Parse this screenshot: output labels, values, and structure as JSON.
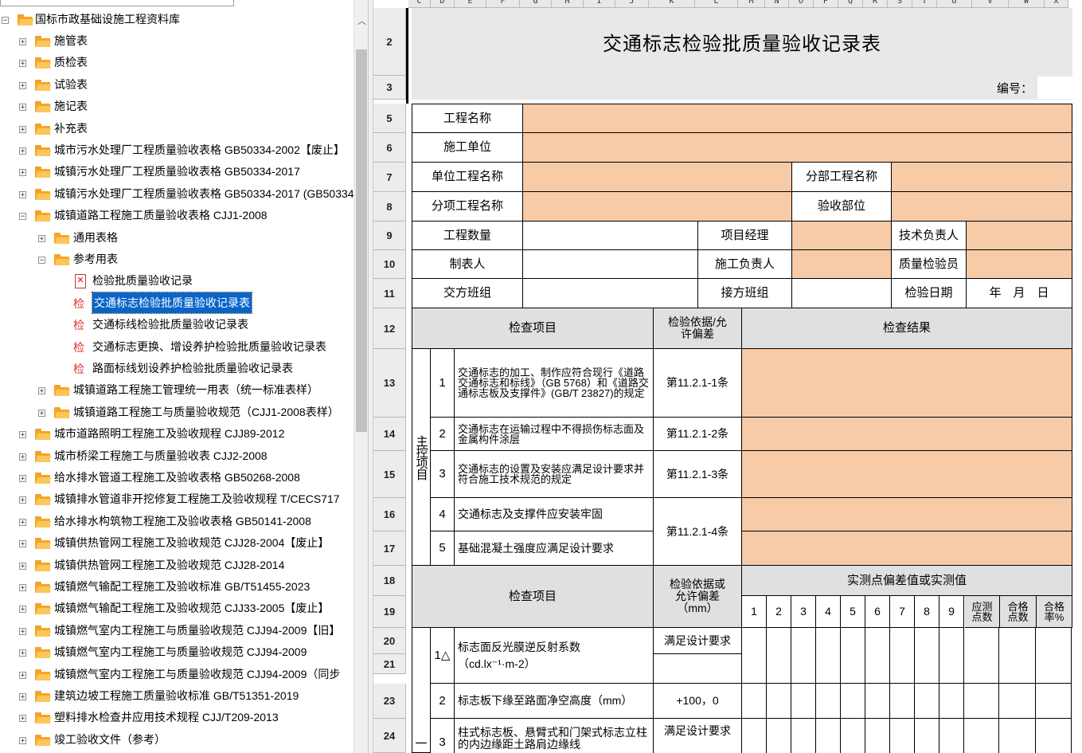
{
  "tree": {
    "root": "国标市政基础设施工程资料库",
    "items": [
      {
        "label": "施管表",
        "level": 1,
        "icon": "folder-icon",
        "exp": "+"
      },
      {
        "label": "质检表",
        "level": 1,
        "icon": "folder-icon",
        "exp": "+"
      },
      {
        "label": "试验表",
        "level": 1,
        "icon": "folder-icon",
        "exp": "+"
      },
      {
        "label": "施记表",
        "level": 1,
        "icon": "folder-icon",
        "exp": "+"
      },
      {
        "label": "补充表",
        "level": 1,
        "icon": "folder-icon",
        "exp": "+"
      },
      {
        "label": "城市污水处理厂工程质量验收表格 GB50334-2002【废止】",
        "level": 1,
        "icon": "folder-icon",
        "exp": "+"
      },
      {
        "label": "城镇污水处理厂工程质量验收表格 GB50334-2017",
        "level": 1,
        "icon": "folder-icon",
        "exp": "+"
      },
      {
        "label": "城镇污水处理厂工程质量验收表格 GB50334-2017 (GB50334",
        "level": 1,
        "icon": "folder-icon",
        "exp": "+"
      },
      {
        "label": "城镇道路工程施工质量验收表格 CJJ1-2008",
        "level": 1,
        "icon": "folder-icon",
        "exp": "-"
      },
      {
        "label": "通用表格",
        "level": 2,
        "icon": "folder-icon",
        "exp": "+"
      },
      {
        "label": "参考用表",
        "level": 2,
        "icon": "folder-icon",
        "exp": "-"
      },
      {
        "label": "检验批质量验收记录",
        "level": 3,
        "icon": "pdf-icon",
        "exp": ""
      },
      {
        "label": "交通标志检验批质量验收记录表",
        "level": 3,
        "icon": "jian-icon",
        "exp": "",
        "selected": true
      },
      {
        "label": "交通标线检验批质量验收记录表",
        "level": 3,
        "icon": "jian-icon",
        "exp": ""
      },
      {
        "label": "交通标志更换、增设养护检验批质量验收记录表",
        "level": 3,
        "icon": "jian-icon",
        "exp": ""
      },
      {
        "label": "路面标线划设养护检验批质量验收记录表",
        "level": 3,
        "icon": "jian-icon",
        "exp": ""
      },
      {
        "label": "城镇道路工程施工管理统一用表（统一标准表样）",
        "level": 2,
        "icon": "folder-icon",
        "exp": "+"
      },
      {
        "label": "城镇道路工程施工与质量验收规范（CJJ1-2008表样）",
        "level": 2,
        "icon": "folder-icon",
        "exp": "+"
      },
      {
        "label": "城市道路照明工程施工及验收规程 CJJ89-2012",
        "level": 1,
        "icon": "folder-icon",
        "exp": "+"
      },
      {
        "label": "城市桥梁工程施工与质量验收表 CJJ2-2008",
        "level": 1,
        "icon": "folder-icon",
        "exp": "+"
      },
      {
        "label": "给水排水管道工程施工及验收表格 GB50268-2008",
        "level": 1,
        "icon": "folder-icon",
        "exp": "+"
      },
      {
        "label": "城镇排水管道非开挖修复工程施工及验收规程 T/CECS717",
        "level": 1,
        "icon": "folder-icon",
        "exp": "+"
      },
      {
        "label": "给水排水构筑物工程施工及验收表格 GB50141-2008",
        "level": 1,
        "icon": "folder-icon",
        "exp": "+"
      },
      {
        "label": "城镇供热管网工程施工及验收规范 CJJ28-2004【废止】",
        "level": 1,
        "icon": "folder-icon",
        "exp": "+"
      },
      {
        "label": "城镇供热管网工程施工及验收规范 CJJ28-2014",
        "level": 1,
        "icon": "folder-icon",
        "exp": "+"
      },
      {
        "label": "城镇燃气输配工程施工及验收标准 GB/T51455-2023",
        "level": 1,
        "icon": "folder-icon",
        "exp": "+"
      },
      {
        "label": "城镇燃气输配工程施工及验收规范 CJJ33-2005【废止】",
        "level": 1,
        "icon": "folder-icon",
        "exp": "+"
      },
      {
        "label": "城镇燃气室内工程施工与质量验收规范 CJJ94-2009【旧】",
        "level": 1,
        "icon": "folder-icon",
        "exp": "+"
      },
      {
        "label": "城镇燃气室内工程施工与质量验收规范 CJJ94-2009",
        "level": 1,
        "icon": "folder-icon",
        "exp": "+"
      },
      {
        "label": "城镇燃气室内工程施工与质量验收规范 CJJ94-2009（同步",
        "level": 1,
        "icon": "folder-icon",
        "exp": "+"
      },
      {
        "label": "建筑边坡工程施工质量验收标准 GB/T51351-2019",
        "level": 1,
        "icon": "folder-icon",
        "exp": "+"
      },
      {
        "label": "塑料排水检查井应用技术规程 CJJ/T209-2013",
        "level": 1,
        "icon": "folder-icon",
        "exp": "+"
      },
      {
        "label": "竣工验收文件（参考）",
        "level": 1,
        "icon": "folder-icon",
        "exp": "+"
      }
    ]
  },
  "sheet": {
    "columns": [
      "C",
      "D",
      "E",
      "F",
      "G",
      "H",
      "I",
      "J",
      "K",
      "L",
      "M",
      "N",
      "O",
      "P",
      "Q",
      "R",
      "S",
      "T",
      "U",
      "V",
      "W",
      "X"
    ],
    "rows": [
      "2",
      "3",
      "5",
      "6",
      "7",
      "8",
      "9",
      "10",
      "11",
      "12",
      "13",
      "14",
      "15",
      "16",
      "17",
      "18",
      "19",
      "20",
      "21",
      "23",
      "24"
    ],
    "title": "交通标志检验批质量验收记录表",
    "code_label": "编号：",
    "project_name": "工程名称",
    "construction_unit": "施工单位",
    "unit_project": "单位工程名称",
    "division_project": "分部工程名称",
    "sub_item_project": "分项工程名称",
    "acceptance_part": "验收部位",
    "project_quantity": "工程数量",
    "project_manager": "项目经理",
    "tech_lead": "技术负责人",
    "tabulator": "制表人",
    "construction_lead": "施工负责人",
    "quality_inspector": "质量检验员",
    "handover_team": "交方班组",
    "receiving_team": "接方班组",
    "inspection_date": "检验日期",
    "date_format": "年　月　日",
    "inspection_item": "检查项目",
    "basis_tolerance": "检验依据/允许偏差",
    "inspection_result": "检查结果",
    "main_control": "主控项目",
    "main_items": [
      {
        "no": "1",
        "text": "交通标志的加工、制作应符合现行《道路交通标志和标线》（GB 5768）和《道路交通标志板及支撑件》(GB/T 23827)的规定",
        "basis": "第11.2.1-1条"
      },
      {
        "no": "2",
        "text": "交通标志在运输过程中不得损伤标志面及金属构件涂层",
        "basis": "第11.2.1-2条"
      },
      {
        "no": "3",
        "text": "交通标志的设置及安装应满足设计要求并符合施工技术规范的规定",
        "basis": "第11.2.1-3条"
      },
      {
        "no": "4",
        "text": "交通标志及支撑件应安装牢固",
        "basis": "第11.2.1-4条"
      },
      {
        "no": "5",
        "text": "基础混凝土强度应满足设计要求",
        "basis": ""
      }
    ],
    "measured_header": "实测点偏差值或实测值",
    "basis_tolerance_mm": "检验依据或允许偏差（mm）",
    "point_numbers": [
      "1",
      "2",
      "3",
      "4",
      "5",
      "6",
      "7",
      "8",
      "9"
    ],
    "should_points": "应测点数",
    "pass_points": "合格点数",
    "pass_rate": "合格率%",
    "general_items": [
      {
        "no": "1△",
        "text": "标志面反光膜逆反射系数",
        "unit": "（cd.lx⁻¹·m-2）",
        "basis": "满足设计要求"
      },
      {
        "no": "2",
        "text": "标志板下缘至路面净空高度（mm）",
        "basis": "+100，0"
      },
      {
        "no": "3",
        "text": "柱式标志板、悬臂式和门架式标志立柱的内边缘距土路肩边缘线",
        "basis": "满足设计要求"
      }
    ],
    "general_mark": "一"
  },
  "colors": {
    "orange": "#f7caa8",
    "gray": "#e0e0e0",
    "selection": "#0a64c8"
  }
}
